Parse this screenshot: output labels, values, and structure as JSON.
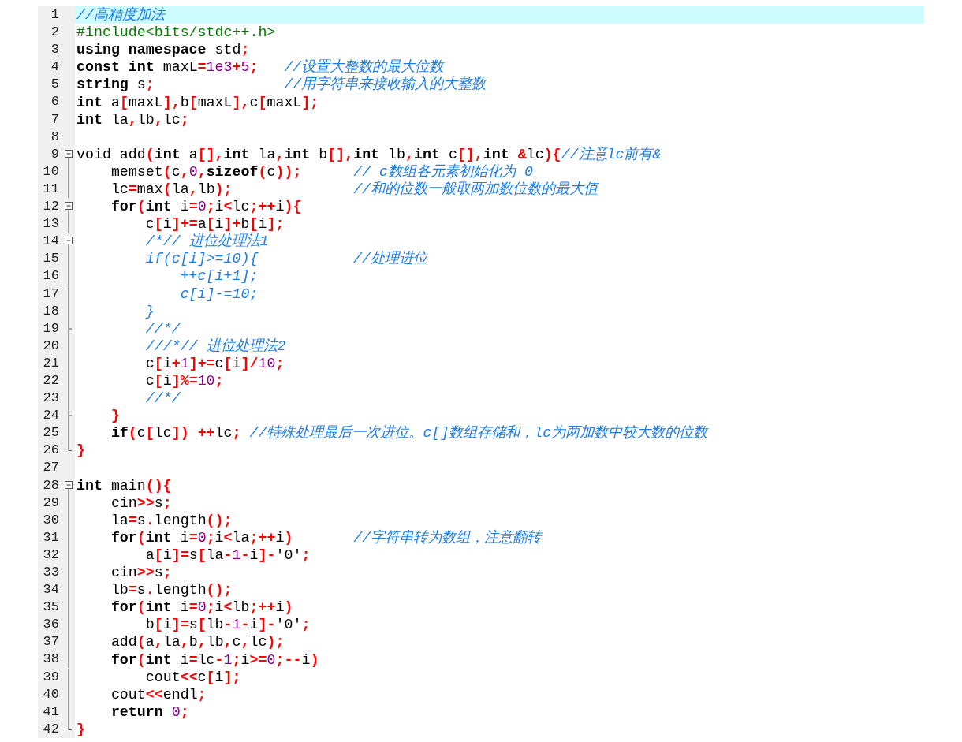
{
  "editor": {
    "lines": [
      {
        "number": "1",
        "current": true,
        "tokens": [
          {
            "kind": "cm",
            "text": "//高精度加法"
          }
        ]
      },
      {
        "number": "2",
        "current": false,
        "tokens": [
          {
            "kind": "pp",
            "text": "#include<bits/stdc++.h>"
          }
        ]
      },
      {
        "number": "3",
        "current": false,
        "tokens": [
          {
            "kind": "kw",
            "text": "using namespace"
          },
          {
            "kind": "id",
            "text": " std"
          },
          {
            "kind": "op",
            "text": ";"
          }
        ]
      },
      {
        "number": "4",
        "current": false,
        "tokens": [
          {
            "kind": "kw",
            "text": "const int"
          },
          {
            "kind": "id",
            "text": " maxL"
          },
          {
            "kind": "op",
            "text": "="
          },
          {
            "kind": "num",
            "text": "1e3"
          },
          {
            "kind": "op",
            "text": "+"
          },
          {
            "kind": "num",
            "text": "5"
          },
          {
            "kind": "op",
            "text": ";"
          },
          {
            "kind": "cm",
            "text": "   //设置大整数的最大位数"
          }
        ]
      },
      {
        "number": "5",
        "current": false,
        "tokens": [
          {
            "kind": "kw",
            "text": "string"
          },
          {
            "kind": "id",
            "text": " s"
          },
          {
            "kind": "op",
            "text": ";"
          },
          {
            "kind": "cm",
            "text": "               //用字符串来接收输入的大整数"
          }
        ]
      },
      {
        "number": "6",
        "current": false,
        "tokens": [
          {
            "kind": "kw",
            "text": "int"
          },
          {
            "kind": "id",
            "text": " a"
          },
          {
            "kind": "op",
            "text": "["
          },
          {
            "kind": "id",
            "text": "maxL"
          },
          {
            "kind": "op",
            "text": "],"
          },
          {
            "kind": "id",
            "text": "b"
          },
          {
            "kind": "op",
            "text": "["
          },
          {
            "kind": "id",
            "text": "maxL"
          },
          {
            "kind": "op",
            "text": "],"
          },
          {
            "kind": "id",
            "text": "c"
          },
          {
            "kind": "op",
            "text": "["
          },
          {
            "kind": "id",
            "text": "maxL"
          },
          {
            "kind": "op",
            "text": "];"
          }
        ]
      },
      {
        "number": "7",
        "current": false,
        "tokens": [
          {
            "kind": "kw",
            "text": "int"
          },
          {
            "kind": "id",
            "text": " la"
          },
          {
            "kind": "op",
            "text": ","
          },
          {
            "kind": "id",
            "text": "lb"
          },
          {
            "kind": "op",
            "text": ","
          },
          {
            "kind": "id",
            "text": "lc"
          },
          {
            "kind": "op",
            "text": ";"
          }
        ]
      },
      {
        "number": "8",
        "current": false
      },
      {
        "number": "9",
        "current": false,
        "fold": {
          "kind": "open"
        },
        "tokens": [
          {
            "kind": "id",
            "text": "void add"
          },
          {
            "kind": "op",
            "text": "("
          },
          {
            "kind": "kw",
            "text": "int"
          },
          {
            "kind": "id",
            "text": " a"
          },
          {
            "kind": "op",
            "text": "[],"
          },
          {
            "kind": "kw",
            "text": "int"
          },
          {
            "kind": "id",
            "text": " la"
          },
          {
            "kind": "op",
            "text": ","
          },
          {
            "kind": "kw",
            "text": "int"
          },
          {
            "kind": "id",
            "text": " b"
          },
          {
            "kind": "op",
            "text": "[],"
          },
          {
            "kind": "kw",
            "text": "int"
          },
          {
            "kind": "id",
            "text": " lb"
          },
          {
            "kind": "op",
            "text": ","
          },
          {
            "kind": "kw",
            "text": "int"
          },
          {
            "kind": "id",
            "text": " c"
          },
          {
            "kind": "op",
            "text": "[],"
          },
          {
            "kind": "kw",
            "text": "int"
          },
          {
            "kind": "op",
            "text": " &"
          },
          {
            "kind": "id",
            "text": "lc"
          },
          {
            "kind": "op",
            "text": "){"
          },
          {
            "kind": "cm",
            "text": "//注意lc前有&"
          }
        ]
      },
      {
        "number": "10",
        "current": false,
        "fold": {
          "kind": "line"
        },
        "tokens": [
          {
            "kind": "id",
            "text": "    memset"
          },
          {
            "kind": "op",
            "text": "("
          },
          {
            "kind": "id",
            "text": "c"
          },
          {
            "kind": "op",
            "text": ","
          },
          {
            "kind": "num",
            "text": "0"
          },
          {
            "kind": "op",
            "text": ","
          },
          {
            "kind": "kw",
            "text": "sizeof"
          },
          {
            "kind": "op",
            "text": "("
          },
          {
            "kind": "id",
            "text": "c"
          },
          {
            "kind": "op",
            "text": "));"
          },
          {
            "kind": "cm",
            "text": "      // c数组各元素初始化为 0"
          }
        ]
      },
      {
        "number": "11",
        "current": false,
        "fold": {
          "kind": "line"
        },
        "tokens": [
          {
            "kind": "id",
            "text": "    lc"
          },
          {
            "kind": "op",
            "text": "="
          },
          {
            "kind": "id",
            "text": "max"
          },
          {
            "kind": "op",
            "text": "("
          },
          {
            "kind": "id",
            "text": "la"
          },
          {
            "kind": "op",
            "text": ","
          },
          {
            "kind": "id",
            "text": "lb"
          },
          {
            "kind": "op",
            "text": ");"
          },
          {
            "kind": "cm",
            "text": "              //和的位数一般取两加数位数的最大值"
          }
        ]
      },
      {
        "number": "12",
        "current": false,
        "fold": {
          "kind": "open"
        },
        "tokens": [
          {
            "kind": "kw",
            "text": "    for"
          },
          {
            "kind": "op",
            "text": "("
          },
          {
            "kind": "kw",
            "text": "int"
          },
          {
            "kind": "id",
            "text": " i"
          },
          {
            "kind": "op",
            "text": "="
          },
          {
            "kind": "num",
            "text": "0"
          },
          {
            "kind": "op",
            "text": ";"
          },
          {
            "kind": "id",
            "text": "i"
          },
          {
            "kind": "op",
            "text": "<"
          },
          {
            "kind": "id",
            "text": "lc"
          },
          {
            "kind": "op",
            "text": ";++"
          },
          {
            "kind": "id",
            "text": "i"
          },
          {
            "kind": "op",
            "text": "){"
          }
        ]
      },
      {
        "number": "13",
        "current": false,
        "fold": {
          "kind": "line"
        },
        "tokens": [
          {
            "kind": "id",
            "text": "        c"
          },
          {
            "kind": "op",
            "text": "["
          },
          {
            "kind": "id",
            "text": "i"
          },
          {
            "kind": "op",
            "text": "]+="
          },
          {
            "kind": "id",
            "text": "a"
          },
          {
            "kind": "op",
            "text": "["
          },
          {
            "kind": "id",
            "text": "i"
          },
          {
            "kind": "op",
            "text": "]+"
          },
          {
            "kind": "id",
            "text": "b"
          },
          {
            "kind": "op",
            "text": "["
          },
          {
            "kind": "id",
            "text": "i"
          },
          {
            "kind": "op",
            "text": "];"
          }
        ]
      },
      {
        "number": "14",
        "current": false,
        "fold": {
          "kind": "open"
        },
        "tokens": [
          {
            "kind": "cm",
            "text": "        /*// 进位处理法1"
          }
        ]
      },
      {
        "number": "15",
        "current": false,
        "fold": {
          "kind": "line"
        },
        "tokens": [
          {
            "kind": "cm",
            "text": "        if(c[i]>=10){           //处理进位"
          }
        ]
      },
      {
        "number": "16",
        "current": false,
        "fold": {
          "kind": "line"
        },
        "tokens": [
          {
            "kind": "cm",
            "text": "            ++c[i+1];"
          }
        ]
      },
      {
        "number": "17",
        "current": false,
        "fold": {
          "kind": "line"
        },
        "tokens": [
          {
            "kind": "cm",
            "text": "            c[i]-=10;"
          }
        ]
      },
      {
        "number": "18",
        "current": false,
        "fold": {
          "kind": "line"
        },
        "tokens": [
          {
            "kind": "cm",
            "text": "        }"
          }
        ]
      },
      {
        "number": "19",
        "current": false,
        "fold": {
          "kind": "tick"
        },
        "tokens": [
          {
            "kind": "cm",
            "text": "        //*/"
          }
        ]
      },
      {
        "number": "20",
        "current": false,
        "fold": {
          "kind": "line"
        },
        "tokens": [
          {
            "kind": "cm",
            "text": "        ///*// 进位处理法2"
          }
        ]
      },
      {
        "number": "21",
        "current": false,
        "fold": {
          "kind": "line"
        },
        "tokens": [
          {
            "kind": "id",
            "text": "        c"
          },
          {
            "kind": "op",
            "text": "["
          },
          {
            "kind": "id",
            "text": "i"
          },
          {
            "kind": "op",
            "text": "+"
          },
          {
            "kind": "num",
            "text": "1"
          },
          {
            "kind": "op",
            "text": "]+="
          },
          {
            "kind": "id",
            "text": "c"
          },
          {
            "kind": "op",
            "text": "["
          },
          {
            "kind": "id",
            "text": "i"
          },
          {
            "kind": "op",
            "text": "]/"
          },
          {
            "kind": "num",
            "text": "10"
          },
          {
            "kind": "op",
            "text": ";"
          }
        ]
      },
      {
        "number": "22",
        "current": false,
        "fold": {
          "kind": "line"
        },
        "tokens": [
          {
            "kind": "id",
            "text": "        c"
          },
          {
            "kind": "op",
            "text": "["
          },
          {
            "kind": "id",
            "text": "i"
          },
          {
            "kind": "op",
            "text": "]%="
          },
          {
            "kind": "num",
            "text": "10"
          },
          {
            "kind": "op",
            "text": ";"
          }
        ]
      },
      {
        "number": "23",
        "current": false,
        "fold": {
          "kind": "line"
        },
        "tokens": [
          {
            "kind": "cm",
            "text": "        //*/"
          }
        ]
      },
      {
        "number": "24",
        "current": false,
        "fold": {
          "kind": "tick"
        },
        "tokens": [
          {
            "kind": "op",
            "text": "    }"
          }
        ]
      },
      {
        "number": "25",
        "current": false,
        "fold": {
          "kind": "line"
        },
        "tokens": [
          {
            "kind": "kw",
            "text": "    if"
          },
          {
            "kind": "op",
            "text": "("
          },
          {
            "kind": "id",
            "text": "c"
          },
          {
            "kind": "op",
            "text": "["
          },
          {
            "kind": "id",
            "text": "lc"
          },
          {
            "kind": "op",
            "text": "]) ++"
          },
          {
            "kind": "id",
            "text": "lc"
          },
          {
            "kind": "op",
            "text": ";"
          },
          {
            "kind": "cm",
            "text": " //特殊处理最后一次进位。c[]数组存储和，lc为两加数中较大数的位数"
          }
        ]
      },
      {
        "number": "26",
        "current": false,
        "fold": {
          "kind": "end"
        },
        "tokens": [
          {
            "kind": "op",
            "text": "}"
          }
        ]
      },
      {
        "number": "27",
        "current": false
      },
      {
        "number": "28",
        "current": false,
        "fold": {
          "kind": "open"
        },
        "tokens": [
          {
            "kind": "kw",
            "text": "int"
          },
          {
            "kind": "id",
            "text": " main"
          },
          {
            "kind": "op",
            "text": "(){"
          }
        ]
      },
      {
        "number": "29",
        "current": false,
        "fold": {
          "kind": "line"
        },
        "tokens": [
          {
            "kind": "id",
            "text": "    cin"
          },
          {
            "kind": "op",
            "text": ">>"
          },
          {
            "kind": "id",
            "text": "s"
          },
          {
            "kind": "op",
            "text": ";"
          }
        ]
      },
      {
        "number": "30",
        "current": false,
        "fold": {
          "kind": "line"
        },
        "tokens": [
          {
            "kind": "id",
            "text": "    la"
          },
          {
            "kind": "op",
            "text": "="
          },
          {
            "kind": "id",
            "text": "s"
          },
          {
            "kind": "op",
            "text": "."
          },
          {
            "kind": "id",
            "text": "length"
          },
          {
            "kind": "op",
            "text": "();"
          }
        ]
      },
      {
        "number": "31",
        "current": false,
        "fold": {
          "kind": "line"
        },
        "tokens": [
          {
            "kind": "kw",
            "text": "    for"
          },
          {
            "kind": "op",
            "text": "("
          },
          {
            "kind": "kw",
            "text": "int"
          },
          {
            "kind": "id",
            "text": " i"
          },
          {
            "kind": "op",
            "text": "="
          },
          {
            "kind": "num",
            "text": "0"
          },
          {
            "kind": "op",
            "text": ";"
          },
          {
            "kind": "id",
            "text": "i"
          },
          {
            "kind": "op",
            "text": "<"
          },
          {
            "kind": "id",
            "text": "la"
          },
          {
            "kind": "op",
            "text": ";++"
          },
          {
            "kind": "id",
            "text": "i"
          },
          {
            "kind": "op",
            "text": ")"
          },
          {
            "kind": "cm",
            "text": "       //字符串转为数组，注意翻转"
          }
        ]
      },
      {
        "number": "32",
        "current": false,
        "fold": {
          "kind": "line"
        },
        "tokens": [
          {
            "kind": "id",
            "text": "        a"
          },
          {
            "kind": "op",
            "text": "["
          },
          {
            "kind": "id",
            "text": "i"
          },
          {
            "kind": "op",
            "text": "]="
          },
          {
            "kind": "id",
            "text": "s"
          },
          {
            "kind": "op",
            "text": "["
          },
          {
            "kind": "id",
            "text": "la"
          },
          {
            "kind": "op",
            "text": "-"
          },
          {
            "kind": "num",
            "text": "1"
          },
          {
            "kind": "op",
            "text": "-"
          },
          {
            "kind": "id",
            "text": "i"
          },
          {
            "kind": "op",
            "text": "]-"
          },
          {
            "kind": "id",
            "text": "'0'"
          },
          {
            "kind": "op",
            "text": ";"
          }
        ]
      },
      {
        "number": "33",
        "current": false,
        "fold": {
          "kind": "line"
        },
        "tokens": [
          {
            "kind": "id",
            "text": "    cin"
          },
          {
            "kind": "op",
            "text": ">>"
          },
          {
            "kind": "id",
            "text": "s"
          },
          {
            "kind": "op",
            "text": ";"
          }
        ]
      },
      {
        "number": "34",
        "current": false,
        "fold": {
          "kind": "line"
        },
        "tokens": [
          {
            "kind": "id",
            "text": "    lb"
          },
          {
            "kind": "op",
            "text": "="
          },
          {
            "kind": "id",
            "text": "s"
          },
          {
            "kind": "op",
            "text": "."
          },
          {
            "kind": "id",
            "text": "length"
          },
          {
            "kind": "op",
            "text": "();"
          }
        ]
      },
      {
        "number": "35",
        "current": false,
        "fold": {
          "kind": "line"
        },
        "tokens": [
          {
            "kind": "kw",
            "text": "    for"
          },
          {
            "kind": "op",
            "text": "("
          },
          {
            "kind": "kw",
            "text": "int"
          },
          {
            "kind": "id",
            "text": " i"
          },
          {
            "kind": "op",
            "text": "="
          },
          {
            "kind": "num",
            "text": "0"
          },
          {
            "kind": "op",
            "text": ";"
          },
          {
            "kind": "id",
            "text": "i"
          },
          {
            "kind": "op",
            "text": "<"
          },
          {
            "kind": "id",
            "text": "lb"
          },
          {
            "kind": "op",
            "text": ";++"
          },
          {
            "kind": "id",
            "text": "i"
          },
          {
            "kind": "op",
            "text": ")"
          }
        ]
      },
      {
        "number": "36",
        "current": false,
        "fold": {
          "kind": "line"
        },
        "tokens": [
          {
            "kind": "id",
            "text": "        b"
          },
          {
            "kind": "op",
            "text": "["
          },
          {
            "kind": "id",
            "text": "i"
          },
          {
            "kind": "op",
            "text": "]="
          },
          {
            "kind": "id",
            "text": "s"
          },
          {
            "kind": "op",
            "text": "["
          },
          {
            "kind": "id",
            "text": "lb"
          },
          {
            "kind": "op",
            "text": "-"
          },
          {
            "kind": "num",
            "text": "1"
          },
          {
            "kind": "op",
            "text": "-"
          },
          {
            "kind": "id",
            "text": "i"
          },
          {
            "kind": "op",
            "text": "]-"
          },
          {
            "kind": "id",
            "text": "'0'"
          },
          {
            "kind": "op",
            "text": ";"
          }
        ]
      },
      {
        "number": "37",
        "current": false,
        "fold": {
          "kind": "line"
        },
        "tokens": [
          {
            "kind": "id",
            "text": "    add"
          },
          {
            "kind": "op",
            "text": "("
          },
          {
            "kind": "id",
            "text": "a"
          },
          {
            "kind": "op",
            "text": ","
          },
          {
            "kind": "id",
            "text": "la"
          },
          {
            "kind": "op",
            "text": ","
          },
          {
            "kind": "id",
            "text": "b"
          },
          {
            "kind": "op",
            "text": ","
          },
          {
            "kind": "id",
            "text": "lb"
          },
          {
            "kind": "op",
            "text": ","
          },
          {
            "kind": "id",
            "text": "c"
          },
          {
            "kind": "op",
            "text": ","
          },
          {
            "kind": "id",
            "text": "lc"
          },
          {
            "kind": "op",
            "text": ");"
          }
        ]
      },
      {
        "number": "38",
        "current": false,
        "fold": {
          "kind": "line"
        },
        "tokens": [
          {
            "kind": "kw",
            "text": "    for"
          },
          {
            "kind": "op",
            "text": "("
          },
          {
            "kind": "kw",
            "text": "int"
          },
          {
            "kind": "id",
            "text": " i"
          },
          {
            "kind": "op",
            "text": "="
          },
          {
            "kind": "id",
            "text": "lc"
          },
          {
            "kind": "op",
            "text": "-"
          },
          {
            "kind": "num",
            "text": "1"
          },
          {
            "kind": "op",
            "text": ";"
          },
          {
            "kind": "id",
            "text": "i"
          },
          {
            "kind": "op",
            "text": ">="
          },
          {
            "kind": "num",
            "text": "0"
          },
          {
            "kind": "op",
            "text": ";--"
          },
          {
            "kind": "id",
            "text": "i"
          },
          {
            "kind": "op",
            "text": ")"
          }
        ]
      },
      {
        "number": "39",
        "current": false,
        "fold": {
          "kind": "line"
        },
        "tokens": [
          {
            "kind": "id",
            "text": "        cout"
          },
          {
            "kind": "op",
            "text": "<<"
          },
          {
            "kind": "id",
            "text": "c"
          },
          {
            "kind": "op",
            "text": "["
          },
          {
            "kind": "id",
            "text": "i"
          },
          {
            "kind": "op",
            "text": "];"
          }
        ]
      },
      {
        "number": "40",
        "current": false,
        "fold": {
          "kind": "line"
        },
        "tokens": [
          {
            "kind": "id",
            "text": "    cout"
          },
          {
            "kind": "op",
            "text": "<<"
          },
          {
            "kind": "id",
            "text": "endl"
          },
          {
            "kind": "op",
            "text": ";"
          }
        ]
      },
      {
        "number": "41",
        "current": false,
        "fold": {
          "kind": "line"
        },
        "tokens": [
          {
            "kind": "kw",
            "text": "    return"
          },
          {
            "kind": "num",
            "text": " 0"
          },
          {
            "kind": "op",
            "text": ";"
          }
        ]
      },
      {
        "number": "42",
        "current": false,
        "fold": {
          "kind": "end"
        },
        "tokens": [
          {
            "kind": "op",
            "text": "}"
          }
        ]
      }
    ]
  }
}
